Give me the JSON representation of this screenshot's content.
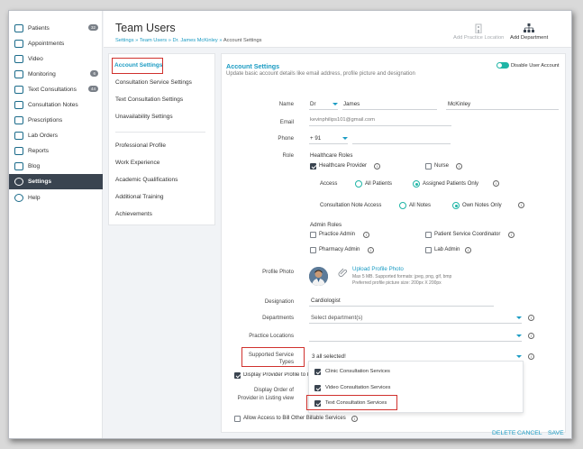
{
  "sidebar": {
    "items": [
      {
        "label": "Patients",
        "badge": "32"
      },
      {
        "label": "Appointments",
        "badge": ""
      },
      {
        "label": "Video",
        "badge": ""
      },
      {
        "label": "Monitoring",
        "badge": "6"
      },
      {
        "label": "Text Consultations",
        "badge": "44"
      },
      {
        "label": "Consultation Notes",
        "badge": ""
      },
      {
        "label": "Prescriptions",
        "badge": ""
      },
      {
        "label": "Lab Orders",
        "badge": ""
      },
      {
        "label": "Reports",
        "badge": ""
      },
      {
        "label": "Blog",
        "badge": ""
      },
      {
        "label": "Settings",
        "badge": ""
      },
      {
        "label": "Help",
        "badge": ""
      }
    ],
    "active_index": 10
  },
  "header": {
    "title": "Team Users",
    "breadcrumb": [
      "Settings",
      "Team Users",
      "Dr. James McKinley",
      "Account Settings"
    ],
    "breadcrumb_sep": "»",
    "add_location": "Add Practice Location",
    "add_department": "Add Department"
  },
  "left_menu": {
    "group1": [
      "Account Settings",
      "Consultation Service Settings",
      "Text Consultation Settings",
      "Unavailability Settings"
    ],
    "group2": [
      "Professional Profile",
      "Work Experience",
      "Academic Qualifications",
      "Additional Training",
      "Achievements"
    ]
  },
  "account": {
    "title": "Account Settings",
    "subtitle": "Update basic account details like email address, profile picture and designation",
    "disable_label": "Disable User Account",
    "name_label": "Name",
    "prefix": "Dr",
    "first_name": "James",
    "last_name": "McKinley",
    "email_label": "Email",
    "email_value": "kevinphilips101@gmail.com",
    "phone_label": "Phone",
    "phone_code": "+ 91",
    "role_label": "Role",
    "healthcare_roles": "Healthcare Roles",
    "healthcare_provider": "Healthcare Provider",
    "nurse": "Nurse",
    "access_label": "Access",
    "all_patients": "All Patients",
    "assigned_patients": "Assigned Patients Only",
    "note_access_label": "Consultation Note Access",
    "all_notes": "All Notes",
    "own_notes": "Own Notes Only",
    "admin_roles": "Admin Roles",
    "practice_admin": "Practice Admin",
    "patient_service_coordinator": "Patient Service Coordinator",
    "pharmacy_admin": "Pharmacy Admin",
    "lab_admin": "Lab Admin",
    "profile_photo_label": "Profile Photo",
    "upload_photo": "Upload Profile Photo",
    "photo_hint1": "Max 5 MB. Supported formats: jpeg, png, gif, bmp",
    "photo_hint2": "Preferred profile picture size: 200px X 200px",
    "designation_label": "Designation",
    "designation_value": "Cardiologist",
    "departments_label": "Departments",
    "departments_placeholder": "Select department(s)",
    "locations_label": "Practice Locations",
    "service_types_label_1": "Supported Service",
    "service_types_label_2": "Types",
    "service_types_value": "3 all selected!",
    "display_profile_label": "Display Provider Profile to P",
    "display_order_label_1": "Display Order of",
    "display_order_label_2": "Provider in Listing view",
    "service_options": [
      "Clinic Consultation Services",
      "Video Consultation Services",
      "Text Consultation Services"
    ],
    "allow_billing_label": "Allow Access to Bill Other Billable Services",
    "delete": "DELETE",
    "cancel": "CANCEL",
    "save": "SAVE"
  },
  "colors": {
    "accent": "#1a9bc3",
    "teal": "#1fb5a6",
    "highlight": "#d0312d",
    "sidebar_active": "#3a4450"
  }
}
